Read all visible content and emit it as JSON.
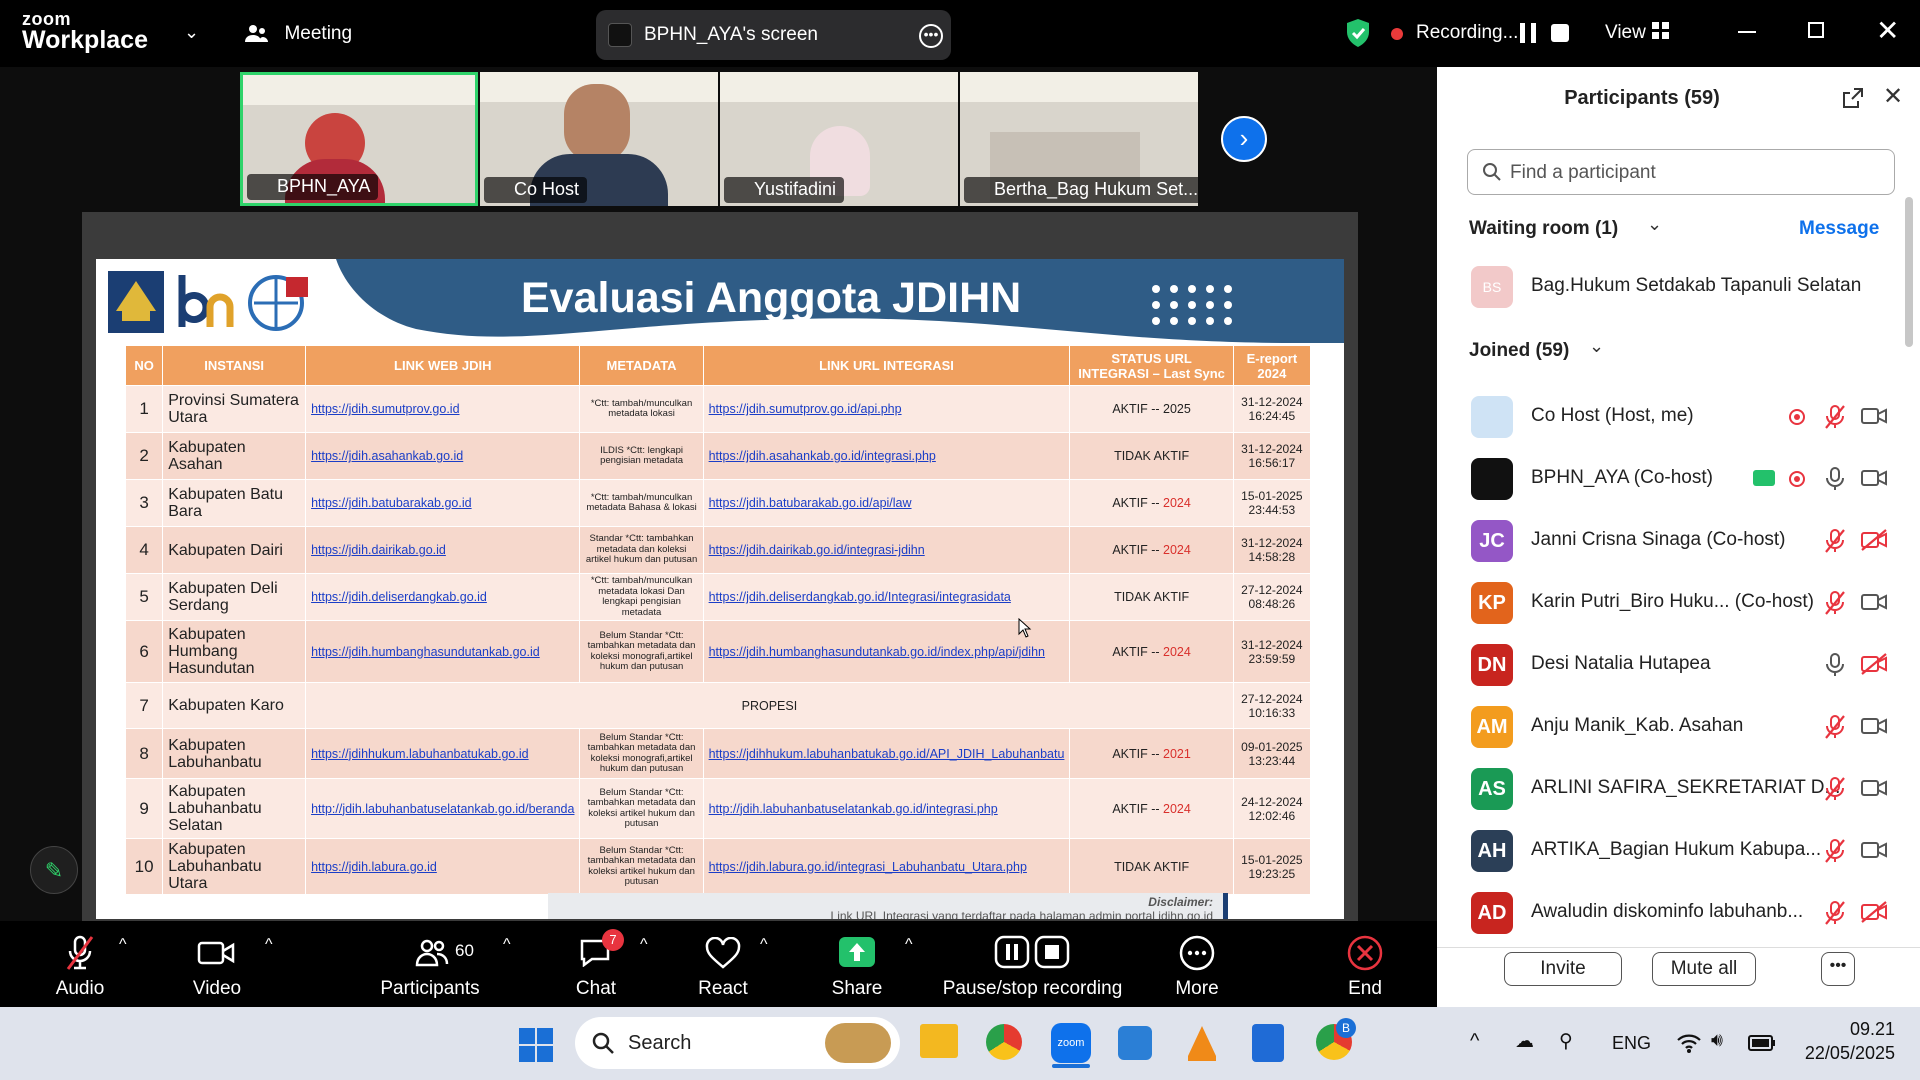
{
  "app": {
    "brand_top": "zoom",
    "brand_bottom": "Workplace",
    "meeting_label": "Meeting",
    "screen_share_label": "BPHN_AYA's screen",
    "recording_label": "Recording...",
    "view_label": "View"
  },
  "thumbnails": [
    {
      "name": "BPHN_AYA"
    },
    {
      "name": "Co Host"
    },
    {
      "name": "Yustifadini"
    },
    {
      "name": "Bertha_Bag Hukum Set..."
    }
  ],
  "slide": {
    "title": "Evaluasi Anggota JDIHN",
    "headers": [
      "NO",
      "INSTANSI",
      "LINK WEB JDIH",
      "METADATA",
      "LINK URL INTEGRASI",
      "STATUS URL INTEGRASI – Last Sync",
      "E-report 2024"
    ],
    "rows": [
      {
        "no": "1",
        "instansi": "Provinsi Sumatera Utara",
        "web": "https://jdih.sumutprov.go.id",
        "meta": "*Ctt: tambah/munculkan metadata lokasi",
        "url": "https://jdih.sumutprov.go.id/api.php",
        "status": "AKTIF -- 2025",
        "status_red": false,
        "report": "31-12-2024 16:24:45",
        "report_red": false
      },
      {
        "no": "2",
        "instansi": "Kabupaten Asahan",
        "web": "https://jdih.asahankab.go.id",
        "meta": "ILDIS *Ctt: lengkapi pengisian metadata",
        "url": "https://jdih.asahankab.go.id/integrasi.php",
        "status": "TIDAK AKTIF",
        "status_red": true,
        "report": "31-12-2024 16:56:17",
        "report_red": false
      },
      {
        "no": "3",
        "instansi": "Kabupaten Batu Bara",
        "web": "https://jdih.batubarakab.go.id",
        "meta": "*Ctt: tambah/munculkan metadata Bahasa & lokasi",
        "url": "https://jdih.batubarakab.go.id/api/law",
        "status_a": "AKTIF -- ",
        "status_b": "2024",
        "report": "15-01-2025 23:44:53",
        "report_red": true
      },
      {
        "no": "4",
        "instansi": "Kabupaten Dairi",
        "web": "https://jdih.dairikab.go.id",
        "meta": "Standar *Ctt: tambahkan metadata dan koleksi artikel hukum dan putusan",
        "url": "https://jdih.dairikab.go.id/integrasi-jdihn",
        "status_a": "AKTIF -- ",
        "status_b": "2024",
        "report": "31-12-2024 14:58:28",
        "report_red": false
      },
      {
        "no": "5",
        "instansi": "Kabupaten Deli Serdang",
        "web": "https://jdih.deliserdangkab.go.id",
        "meta": "*Ctt: tambah/munculkan metadata lokasi Dan lengkapi pengisian metadata",
        "url": "https://jdih.deliserdangkab.go.id/Integrasi/integrasidata",
        "status": "TIDAK AKTIF",
        "status_red": true,
        "report": "27-12-2024 08:48:26",
        "report_red": false
      },
      {
        "no": "6",
        "instansi": "Kabupaten Humbang Hasundutan",
        "web": "https://jdih.humbanghasundutankab.go.id",
        "meta": "Belum Standar *Ctt: tambahkan metadata dan koleksi monografi,artikel hukum dan putusan",
        "url": "https://jdih.humbanghasundutankab.go.id/index.php/api/jdihn",
        "status_a": "AKTIF -- ",
        "status_b": "2024",
        "report": "31-12-2024 23:59:59",
        "report_red": false
      },
      {
        "no": "7",
        "instansi": "Kabupaten Karo",
        "merged": "PROPESI",
        "report": "27-12-2024 10:16:33",
        "report_red": false
      },
      {
        "no": "8",
        "instansi": "Kabupaten Labuhanbatu",
        "web": "https://jdihhukum.labuhanbatukab.go.id",
        "meta": "Belum Standar *Ctt: tambahkan metadata dan koleksi monografi,artikel hukum dan putusan",
        "url": "https://jdihhukum.labuhanbatukab.go.id/API_JDIH_Labuhanbatu",
        "status_a": "AKTIF -- ",
        "status_b": "2021",
        "report": "09-01-2025 13:23:44",
        "report_red": true
      },
      {
        "no": "9",
        "instansi": "Kabupaten Labuhanbatu Selatan",
        "web": "http://jdih.labuhanbatuselatankab.go.id/beranda",
        "meta": "Belum Standar *Ctt: tambahkan metadata dan koleksi artikel hukum dan putusan",
        "url": "http://jdih.labuhanbatuselatankab.go.id/integrasi.php",
        "status_a": "AKTIF -- ",
        "status_b": "2024",
        "report": "24-12-2024 12:02:46",
        "report_red": false
      },
      {
        "no": "10",
        "instansi": "Kabupaten Labuhanbatu Utara",
        "web": "https://jdih.labura.go.id",
        "meta": "Belum Standar *Ctt: tambahkan metadata dan koleksi artikel hukum dan putusan",
        "url": "https://jdih.labura.go.id/integrasi_Labuhanbatu_Utara.php",
        "status": "TIDAK AKTIF",
        "status_red": true,
        "report": "15-01-2025 19:23:25",
        "report_red": true
      }
    ],
    "disclaimer_label": "Disclaimer:",
    "disclaimer_text": "Link URL Integrasi yang terdaftar pada halaman admin portal jdihn.go.id"
  },
  "panel": {
    "title": "Participants (59)",
    "search_placeholder": "Find a participant",
    "waiting_label": "Waiting room (1)",
    "message_label": "Message",
    "waiting": [
      {
        "initials": "BS",
        "name": "Bag.Hukum Setdakab Tapanuli Selatan",
        "color": "#f2c9c9"
      }
    ],
    "joined_label": "Joined (59)",
    "participants": [
      {
        "initials": "",
        "name": "Co Host (Host, me)",
        "color": "#cfe3f5",
        "muted": true,
        "video_off": false,
        "rec": true
      },
      {
        "initials": "",
        "name": "BPHN_AYA (Co-host)",
        "color": "#111111",
        "muted": false,
        "video_off": false,
        "rec": true,
        "share": true
      },
      {
        "initials": "JC",
        "name": "Janni Crisna Sinaga (Co-host)",
        "color": "#9457c6",
        "muted": true,
        "video_off": true
      },
      {
        "initials": "KP",
        "name": "Karin Putri_Biro Huku... (Co-host)",
        "color": "#e2641c",
        "muted": true,
        "video_off": false
      },
      {
        "initials": "DN",
        "name": "Desi Natalia Hutapea",
        "color": "#c8251f",
        "muted": false,
        "video_off": true
      },
      {
        "initials": "AM",
        "name": "Anju Manik_Kab. Asahan",
        "color": "#f39c1e",
        "muted": true,
        "video_off": false
      },
      {
        "initials": "AS",
        "name": "ARLINI SAFIRA_SEKRETARIAT D...",
        "color": "#1a9a55",
        "muted": true,
        "video_off": false
      },
      {
        "initials": "AH",
        "name": "ARTIKA_Bagian Hukum Kabupa...",
        "color": "#2b3f57",
        "muted": true,
        "video_off": false
      },
      {
        "initials": "AD",
        "name": "Awaludin diskominfo labuhanb...",
        "color": "#c8251f",
        "muted": true,
        "video_off": true
      }
    ],
    "invite_label": "Invite",
    "mute_all_label": "Mute all"
  },
  "toolbar": {
    "audio": "Audio",
    "video": "Video",
    "participants": "Participants",
    "participants_count": "60",
    "chat": "Chat",
    "chat_badge": "7",
    "react": "React",
    "share": "Share",
    "recording": "Pause/stop recording",
    "more": "More",
    "end": "End"
  },
  "taskbar": {
    "search": "Search",
    "lang": "ENG",
    "time": "09.21",
    "date": "22/05/2025",
    "chrome_badge": "B"
  }
}
